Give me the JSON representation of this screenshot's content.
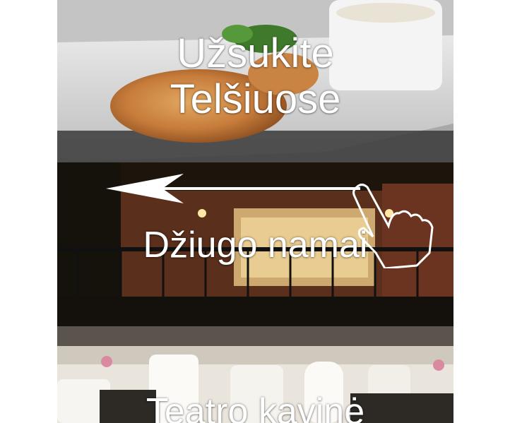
{
  "cards": [
    {
      "title_line1": "Užsukite",
      "title_line2": "Telšiuose"
    },
    {
      "title": "Džiugo namai"
    },
    {
      "title": "Teatro kavinė"
    }
  ],
  "gesture": {
    "icon": "hand-pointer-icon",
    "direction": "swipe-left"
  }
}
